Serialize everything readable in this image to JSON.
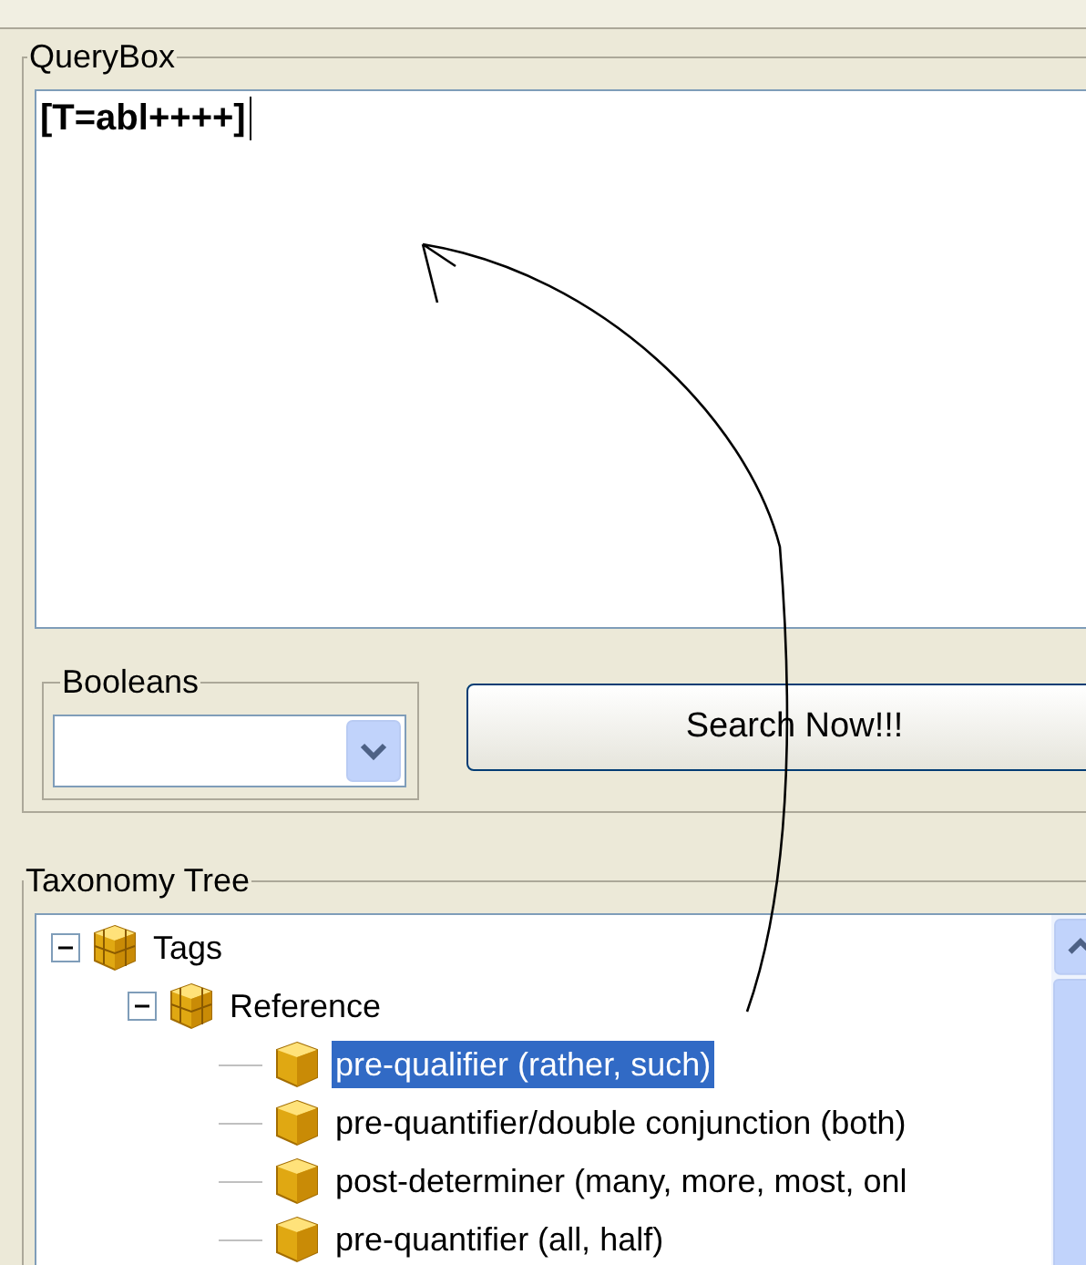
{
  "query_box": {
    "title": "QueryBox",
    "value": "[T=abl++++]"
  },
  "booleans": {
    "title": "Booleans"
  },
  "search_button": {
    "label": "Search Now!!!"
  },
  "taxonomy_tree": {
    "title": "Taxonomy Tree",
    "nodes": [
      {
        "label": "Tags",
        "expanded": true,
        "selected": false,
        "children": [
          {
            "label": "Reference",
            "expanded": true,
            "selected": false,
            "children": [
              {
                "label": "pre-qualifier (rather, such)",
                "selected": true
              },
              {
                "label": "pre-quantifier/double conjunction (both)",
                "selected": false
              },
              {
                "label": "post-determiner (many, more, most, onl",
                "selected": false
              },
              {
                "label": "pre-quantifier (all, half)",
                "selected": false
              }
            ]
          }
        ]
      }
    ]
  }
}
